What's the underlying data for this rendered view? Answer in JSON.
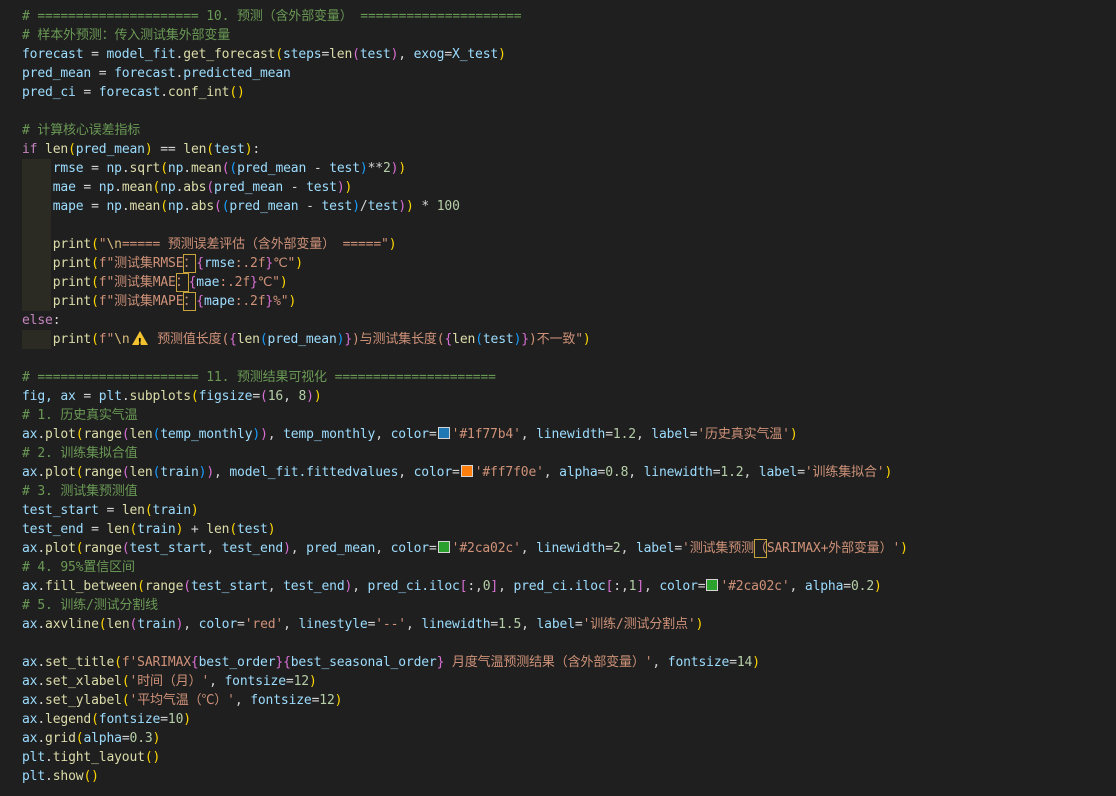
{
  "code": {
    "l1": "# ===================== 10. 预测（含外部变量） =====================",
    "l2": "# 样本外预测：传入测试集外部变量",
    "l3_var": "forecast",
    "l3_mid": "model_fit.get_forecast",
    "l3_arg1": "steps",
    "l3_arg1v": "len",
    "l3_arg1a": "test",
    "l3_arg2": "exog",
    "l3_arg2v": "X_test",
    "l4_var": "pred_mean",
    "l4_rhs": "forecast.predicted_mean",
    "l5_var": "pred_ci",
    "l5_rhs": "forecast.conf_int",
    "l7": "# 计算核心误差指标",
    "l8_kw": "if",
    "l8_fn": "len",
    "l8_a": "pred_mean",
    "l8_b": "test",
    "l9_var": "rmse",
    "l9_np": "np",
    "l9_f1": "sqrt",
    "l9_f2": "mean",
    "l9_a": "pred_mean",
    "l9_b": "test",
    "l9_pow": "2",
    "l10_var": "mae",
    "l10_np": "np",
    "l10_f1": "mean",
    "l10_f2": "abs",
    "l10_a": "pred_mean",
    "l10_b": "test",
    "l11_var": "mape",
    "l11_np": "np",
    "l11_f1": "mean",
    "l11_f2": "abs",
    "l11_a": "pred_mean",
    "l11_b": "test",
    "l11_n": "100",
    "l13_fn": "print",
    "l13_s1": "\"",
    "l13_esc": "\\n",
    "l13_s2": "===== 预测误差评估（含外部变量） =====\"",
    "l14_fn": "print",
    "l14_s": "f\"测试集RMSE",
    "l14_colon": "：",
    "l14_fmt": "rmse",
    "l14_spec": ":.2f",
    "l14_tail": "℃\"",
    "l15_fn": "print",
    "l15_s": "f\"测试集MAE",
    "l15_colon": "：",
    "l15_fmt": "mae",
    "l15_spec": ":.2f",
    "l15_tail": "℃\"",
    "l16_fn": "print",
    "l16_s": "f\"测试集MAPE",
    "l16_colon": "：",
    "l16_fmt": "mape",
    "l16_spec": ":.2f",
    "l16_tail": "%\"",
    "l17_kw": "else",
    "l18_fn": "print",
    "l18_s1": "f\"",
    "l18_esc": "\\n",
    "l18_s2": " 预测值长度(",
    "l18_len1": "len",
    "l18_a": "pred_mean",
    "l18_s3": ")与测试集长度(",
    "l18_len2": "len",
    "l18_b": "test",
    "l18_s4": ")不一致\"",
    "l20": "# ===================== 11. 预测结果可视化 =====================",
    "l21_a": "fig, ax",
    "l21_b": "plt.subplots",
    "l21_c": "figsize",
    "l21_d": "16",
    "l21_e": "8",
    "l22": "# 1. 历史真实气温",
    "l23_pre": "ax.plot",
    "l23_range": "range",
    "l23_len": "len",
    "l23_v": "temp_monthly",
    "l23_v2": "temp_monthly",
    "l23_color": "color",
    "l23_hex": "'#1f77b4'",
    "l23_lw": "linewidth",
    "l23_lwv": "1.2",
    "l23_label": "label",
    "l23_labelv": "'历史真实气温'",
    "l24": "# 2. 训练集拟合值",
    "l25_pre": "ax.plot",
    "l25_range": "range",
    "l25_len": "len",
    "l25_v": "train",
    "l25_fv": "model_fit.fittedvalues",
    "l25_color": "color",
    "l25_hex": "'#ff7f0e'",
    "l25_alpha": "alpha",
    "l25_alphav": "0.8",
    "l25_lw": "linewidth",
    "l25_lwv": "1.2",
    "l25_label": "label",
    "l25_labelv": "'训练集拟合'",
    "l26": "# 3. 测试集预测值",
    "l27_var": "test_start",
    "l27_len": "len",
    "l27_v": "train",
    "l28_var": "test_end",
    "l28_len1": "len",
    "l28_v1": "train",
    "l28_len2": "len",
    "l28_v2": "test",
    "l29_pre": "ax.plot",
    "l29_range": "range",
    "l29_a": "test_start",
    "l29_b": "test_end",
    "l29_pm": "pred_mean",
    "l29_color": "color",
    "l29_hex": "'#2ca02c'",
    "l29_lw": "linewidth",
    "l29_lwv": "2",
    "l29_label": "label",
    "l29_labelv1": "'测试集预测",
    "l29_labelhl": "（",
    "l29_labelv2": "SARIMAX+外部变量）'",
    "l30": "# 4. 95%置信区间",
    "l31_pre": "ax.fill_between",
    "l31_range": "range",
    "l31_a": "test_start",
    "l31_b": "test_end",
    "l31_ci1": "pred_ci.iloc",
    "l31_i1": "0",
    "l31_ci2": "pred_ci.iloc",
    "l31_i2": "1",
    "l31_color": "color",
    "l31_hex": "'#2ca02c'",
    "l31_alpha": "alpha",
    "l31_alphav": "0.2",
    "l32": "# 5. 训练/测试分割线",
    "l33_pre": "ax.axvline",
    "l33_len": "len",
    "l33_v": "train",
    "l33_color": "color",
    "l33_cv": "'red'",
    "l33_ls": "linestyle",
    "l33_lsv": "'--'",
    "l33_lw": "linewidth",
    "l33_lwv": "1.5",
    "l33_label": "label",
    "l33_labelv": "'训练/测试分割点'",
    "l35_pre": "ax.set_title",
    "l35_s1": "f'SARIMAX",
    "l35_f1": "best_order",
    "l35_f2": "best_seasonal_order",
    "l35_s2": " 月度气温预测结果（含外部变量）'",
    "l35_fs": "fontsize",
    "l35_fsv": "14",
    "l36_pre": "ax.set_xlabel",
    "l36_s": "'时间（月）'",
    "l36_fs": "fontsize",
    "l36_fsv": "12",
    "l37_pre": "ax.set_ylabel",
    "l37_s": "'平均气温（℃）'",
    "l37_fs": "fontsize",
    "l37_fsv": "12",
    "l38_pre": "ax.legend",
    "l38_fs": "fontsize",
    "l38_fsv": "10",
    "l39_pre": "ax.grid",
    "l39_a": "alpha",
    "l39_av": "0.3",
    "l40": "plt.tight_layout",
    "l41": "plt.show"
  },
  "colors": {
    "background": "#1f1f1f",
    "swatch_blue": "#1f77b4",
    "swatch_orange": "#ff7f0e",
    "swatch_green": "#2ca02c",
    "warning": "#f2c230"
  }
}
